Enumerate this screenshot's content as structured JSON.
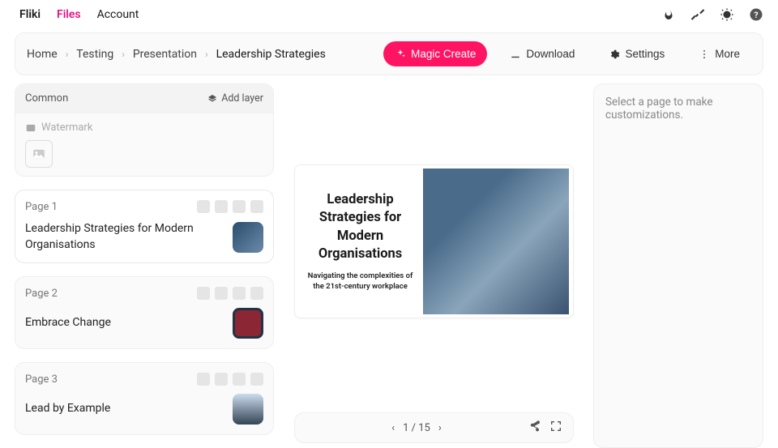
{
  "brand": "Fliki",
  "nav": {
    "files": "Files",
    "account": "Account"
  },
  "breadcrumb": [
    "Home",
    "Testing",
    "Presentation",
    "Leadership Strategies"
  ],
  "actions": {
    "magic": "Magic Create",
    "download": "Download",
    "settings": "Settings",
    "more": "More"
  },
  "common": {
    "label": "Common",
    "add_layer": "Add layer",
    "watermark": "Watermark"
  },
  "pages": [
    {
      "label": "Page 1",
      "title": "Leadership Strategies for Modern Organisations"
    },
    {
      "label": "Page 2",
      "title": "Embrace Change"
    },
    {
      "label": "Page 3",
      "title": "Lead by Example"
    }
  ],
  "slide": {
    "title": "Leadership Strategies for Modern Organisations",
    "subtitle": "Navigating the complexities of the 21st-century workplace"
  },
  "pager": {
    "current": 1,
    "total": 15,
    "sep": " / "
  },
  "right_panel": "Select a page to make customizations."
}
